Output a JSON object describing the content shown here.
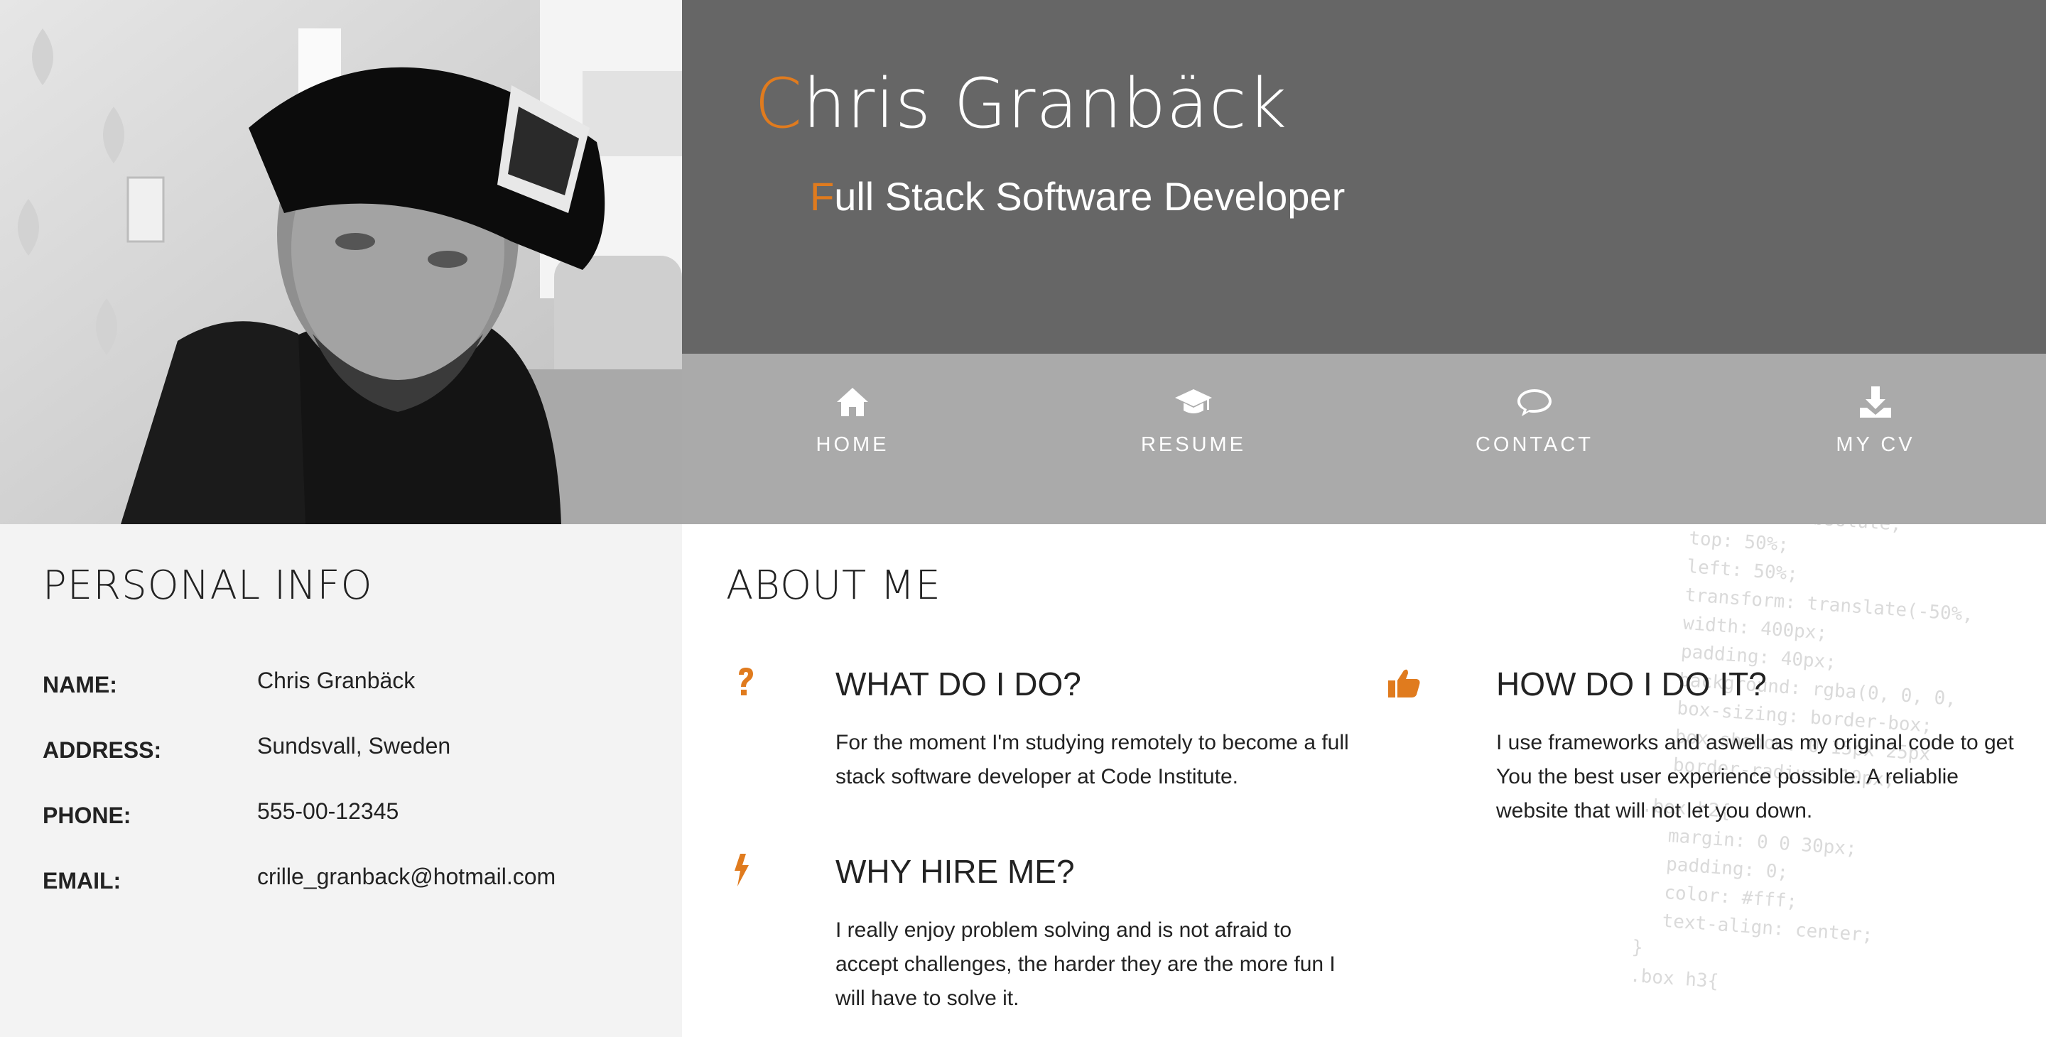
{
  "header": {
    "name_first_letter": "C",
    "name_rest": "hris Granbäck",
    "role_first_letter": "F",
    "role_rest": "ull Stack Software Developer"
  },
  "nav": [
    {
      "label": "HOME",
      "icon": "home-icon"
    },
    {
      "label": "RESUME",
      "icon": "graduation-cap-icon"
    },
    {
      "label": "CONTACT",
      "icon": "speech-bubble-icon"
    },
    {
      "label": "MY CV",
      "icon": "download-icon"
    }
  ],
  "personal_info": {
    "title": "PERSONAL INFO",
    "rows": [
      {
        "key": "NAME:",
        "value": "Chris Granbäck"
      },
      {
        "key": "ADDRESS:",
        "value": "Sundsvall, Sweden"
      },
      {
        "key": "PHONE:",
        "value": "555-00-12345"
      },
      {
        "key": "EMAIL:",
        "value": "crille_granback@hotmail.com"
      }
    ]
  },
  "about": {
    "title": "ABOUT ME",
    "features": [
      {
        "icon": "question-mark-icon",
        "title": "WHAT DO I DO?",
        "text": "For the moment I'm studying remotely to become a full stack software developer at Code Institute."
      },
      {
        "icon": "thumbs-up-icon",
        "title": "HOW DO I DO IT?",
        "text": "I use frameworks and aswell as my original code to get You the best user experience possible. A reliablie website that will not let you down."
      },
      {
        "icon": "lightning-bolt-icon",
        "title": "WHY HIRE ME?",
        "text": "I really enjoy problem solving and is not afraid to accept challenges, the harder they are the more fun I will have to solve it."
      }
    ]
  },
  "colors": {
    "accent": "#e07b1e",
    "header_bg": "#666666",
    "nav_bg": "#aaaaaa",
    "info_bg": "#f3f3f3"
  }
}
